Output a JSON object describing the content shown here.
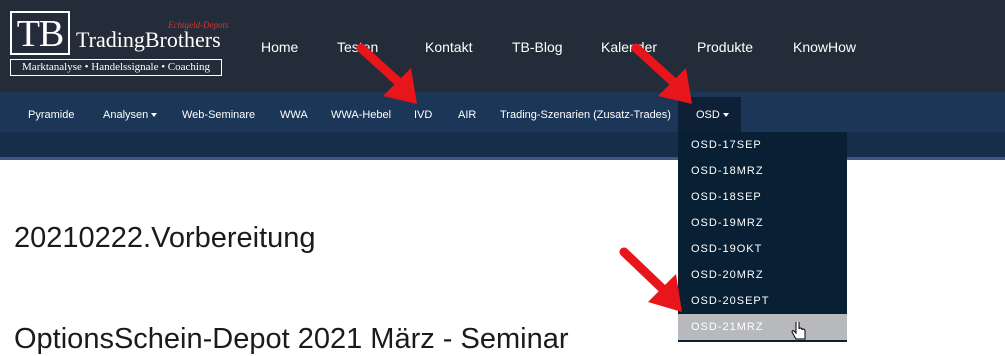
{
  "logo": {
    "initials": "TB",
    "name": "TradingBrothers",
    "sub": "Echtgeld-Depots",
    "tagline": "Marktanalyse • Handelssignale • Coaching"
  },
  "topnav": [
    "Home",
    "Testen",
    "Kontakt",
    "TB-Blog",
    "Kalender",
    "Produkte",
    "KnowHow"
  ],
  "subnav": {
    "items": [
      "Pyramide",
      "Analysen",
      "Web-Seminare",
      "WWA",
      "WWA-Hebel",
      "IVD",
      "AIR",
      "Trading-Szenarien (Zusatz-Trades)",
      "OSD"
    ]
  },
  "dropdown": {
    "items": [
      "OSD-17SEP",
      "OSD-18MRZ",
      "OSD-18SEP",
      "OSD-19MRZ",
      "OSD-19OKT",
      "OSD-20MRZ",
      "OSD-20SEPT",
      "OSD-21MRZ"
    ],
    "hovered": "OSD-21MRZ"
  },
  "page": {
    "title": "20210222.Vorbereitung",
    "subtitle_partial": "OptionsSchein-Depot 2021 März - Seminar"
  },
  "colors": {
    "topbar": "#232c38",
    "subbar": "#1b3656",
    "dropdown": "#081f34",
    "annotation_arrow": "#e8151b"
  },
  "icons": [
    "hand-pointer-icon",
    "red-arrow-icon"
  ]
}
